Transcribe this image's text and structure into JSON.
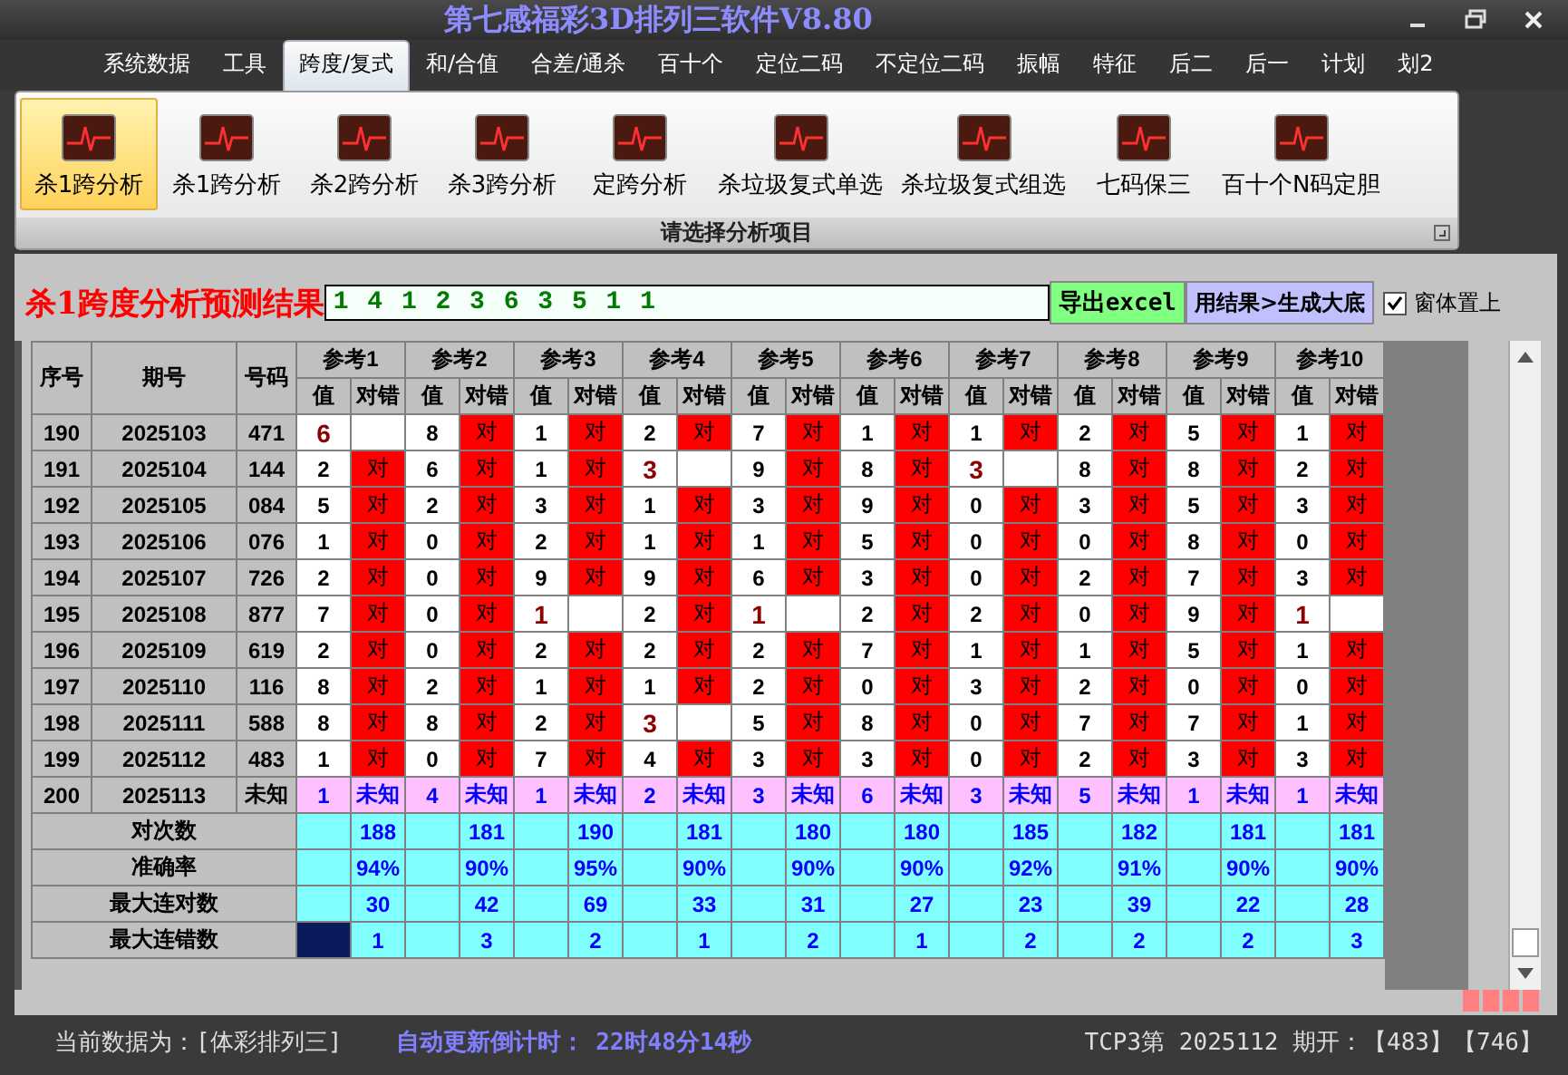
{
  "window": {
    "title": "第七感福彩3D排列三软件V8.80"
  },
  "menu": [
    {
      "label": "系统数据",
      "selected": false
    },
    {
      "label": "工具",
      "selected": false
    },
    {
      "label": "跨度/复式",
      "selected": true
    },
    {
      "label": "和/合值",
      "selected": false
    },
    {
      "label": "合差/通杀",
      "selected": false
    },
    {
      "label": "百十个",
      "selected": false
    },
    {
      "label": "定位二码",
      "selected": false
    },
    {
      "label": "不定位二码",
      "selected": false
    },
    {
      "label": "振幅",
      "selected": false
    },
    {
      "label": "特征",
      "selected": false
    },
    {
      "label": "后二",
      "selected": false
    },
    {
      "label": "后一",
      "selected": false
    },
    {
      "label": "计划",
      "selected": false
    },
    {
      "label": "划2",
      "selected": false
    }
  ],
  "ribbon": {
    "items": [
      {
        "label": "杀1跨分析",
        "selected": true
      },
      {
        "label": "杀1跨分析",
        "selected": false
      },
      {
        "label": "杀2跨分析",
        "selected": false
      },
      {
        "label": "杀3跨分析",
        "selected": false
      },
      {
        "label": "定跨分析",
        "selected": false
      },
      {
        "label": "杀垃圾复式单选",
        "selected": false
      },
      {
        "label": "杀垃圾复式组选",
        "selected": false
      },
      {
        "label": "七码保三",
        "selected": false
      },
      {
        "label": "百十个N码定胆",
        "selected": false
      }
    ],
    "group_label": "请选择分析项目"
  },
  "result": {
    "title": "杀1跨度分析预测结果",
    "value": "1 4 1 2 3 6 3 5 1 1",
    "export_button": "导出excel",
    "generate_button": "用结果>生成大底",
    "pin_checkbox": {
      "label": "窗体置上",
      "checked": true
    }
  },
  "table": {
    "columns": [
      "序号",
      "期号",
      "号码"
    ],
    "groups": [
      {
        "label": "参考1",
        "subcolumns": [
          "值",
          "对错"
        ]
      },
      {
        "label": "参考2",
        "subcolumns": [
          "值",
          "对错"
        ]
      },
      {
        "label": "参考3",
        "subcolumns": [
          "值",
          "对错"
        ]
      },
      {
        "label": "参考4",
        "subcolumns": [
          "值",
          "对错"
        ]
      },
      {
        "label": "参考5",
        "subcolumns": [
          "值",
          "对错"
        ]
      },
      {
        "label": "参考6",
        "subcolumns": [
          "值",
          "对错"
        ]
      },
      {
        "label": "参考7",
        "subcolumns": [
          "值",
          "对错"
        ]
      },
      {
        "label": "参考8",
        "subcolumns": [
          "值",
          "对错"
        ]
      },
      {
        "label": "参考9",
        "subcolumns": [
          "值",
          "对错"
        ]
      },
      {
        "label": "参考10",
        "subcolumns": [
          "值",
          "对错"
        ]
      }
    ],
    "rows": [
      {
        "kind": "history",
        "seq": "190",
        "period": "2025103",
        "number": "471",
        "cells": [
          {
            "value": "6",
            "hit": false
          },
          {
            "value": "8",
            "hit": true,
            "result": "对"
          },
          {
            "value": "1",
            "hit": true,
            "result": "对"
          },
          {
            "value": "2",
            "hit": true,
            "result": "对"
          },
          {
            "value": "7",
            "hit": true,
            "result": "对"
          },
          {
            "value": "1",
            "hit": true,
            "result": "对"
          },
          {
            "value": "1",
            "hit": true,
            "result": "对"
          },
          {
            "value": "2",
            "hit": true,
            "result": "对"
          },
          {
            "value": "5",
            "hit": true,
            "result": "对"
          },
          {
            "value": "1",
            "hit": true,
            "result": "对"
          }
        ]
      },
      {
        "kind": "history",
        "seq": "191",
        "period": "2025104",
        "number": "144",
        "cells": [
          {
            "value": "2",
            "hit": true,
            "result": "对"
          },
          {
            "value": "6",
            "hit": true,
            "result": "对"
          },
          {
            "value": "1",
            "hit": true,
            "result": "对"
          },
          {
            "value": "3",
            "hit": false
          },
          {
            "value": "9",
            "hit": true,
            "result": "对"
          },
          {
            "value": "8",
            "hit": true,
            "result": "对"
          },
          {
            "value": "3",
            "hit": false
          },
          {
            "value": "8",
            "hit": true,
            "result": "对"
          },
          {
            "value": "8",
            "hit": true,
            "result": "对"
          },
          {
            "value": "2",
            "hit": true,
            "result": "对"
          }
        ]
      },
      {
        "kind": "history",
        "seq": "192",
        "period": "2025105",
        "number": "084",
        "cells": [
          {
            "value": "5",
            "hit": true,
            "result": "对"
          },
          {
            "value": "2",
            "hit": true,
            "result": "对"
          },
          {
            "value": "3",
            "hit": true,
            "result": "对"
          },
          {
            "value": "1",
            "hit": true,
            "result": "对"
          },
          {
            "value": "3",
            "hit": true,
            "result": "对"
          },
          {
            "value": "9",
            "hit": true,
            "result": "对"
          },
          {
            "value": "0",
            "hit": true,
            "result": "对"
          },
          {
            "value": "3",
            "hit": true,
            "result": "对"
          },
          {
            "value": "5",
            "hit": true,
            "result": "对"
          },
          {
            "value": "3",
            "hit": true,
            "result": "对"
          }
        ]
      },
      {
        "kind": "history",
        "seq": "193",
        "period": "2025106",
        "number": "076",
        "cells": [
          {
            "value": "1",
            "hit": true,
            "result": "对"
          },
          {
            "value": "0",
            "hit": true,
            "result": "对"
          },
          {
            "value": "2",
            "hit": true,
            "result": "对"
          },
          {
            "value": "1",
            "hit": true,
            "result": "对"
          },
          {
            "value": "1",
            "hit": true,
            "result": "对"
          },
          {
            "value": "5",
            "hit": true,
            "result": "对"
          },
          {
            "value": "0",
            "hit": true,
            "result": "对"
          },
          {
            "value": "0",
            "hit": true,
            "result": "对"
          },
          {
            "value": "8",
            "hit": true,
            "result": "对"
          },
          {
            "value": "0",
            "hit": true,
            "result": "对"
          }
        ]
      },
      {
        "kind": "history",
        "seq": "194",
        "period": "2025107",
        "number": "726",
        "cells": [
          {
            "value": "2",
            "hit": true,
            "result": "对"
          },
          {
            "value": "0",
            "hit": true,
            "result": "对"
          },
          {
            "value": "9",
            "hit": true,
            "result": "对"
          },
          {
            "value": "9",
            "hit": true,
            "result": "对"
          },
          {
            "value": "6",
            "hit": true,
            "result": "对"
          },
          {
            "value": "3",
            "hit": true,
            "result": "对"
          },
          {
            "value": "0",
            "hit": true,
            "result": "对"
          },
          {
            "value": "2",
            "hit": true,
            "result": "对"
          },
          {
            "value": "7",
            "hit": true,
            "result": "对"
          },
          {
            "value": "3",
            "hit": true,
            "result": "对"
          }
        ]
      },
      {
        "kind": "history",
        "seq": "195",
        "period": "2025108",
        "number": "877",
        "cells": [
          {
            "value": "7",
            "hit": true,
            "result": "对"
          },
          {
            "value": "0",
            "hit": true,
            "result": "对"
          },
          {
            "value": "1",
            "hit": false
          },
          {
            "value": "2",
            "hit": true,
            "result": "对"
          },
          {
            "value": "1",
            "hit": false
          },
          {
            "value": "2",
            "hit": true,
            "result": "对"
          },
          {
            "value": "2",
            "hit": true,
            "result": "对"
          },
          {
            "value": "0",
            "hit": true,
            "result": "对"
          },
          {
            "value": "9",
            "hit": true,
            "result": "对"
          },
          {
            "value": "1",
            "hit": false
          }
        ]
      },
      {
        "kind": "history",
        "seq": "196",
        "period": "2025109",
        "number": "619",
        "cells": [
          {
            "value": "2",
            "hit": true,
            "result": "对"
          },
          {
            "value": "0",
            "hit": true,
            "result": "对"
          },
          {
            "value": "2",
            "hit": true,
            "result": "对"
          },
          {
            "value": "2",
            "hit": true,
            "result": "对"
          },
          {
            "value": "2",
            "hit": true,
            "result": "对"
          },
          {
            "value": "7",
            "hit": true,
            "result": "对"
          },
          {
            "value": "1",
            "hit": true,
            "result": "对"
          },
          {
            "value": "1",
            "hit": true,
            "result": "对"
          },
          {
            "value": "5",
            "hit": true,
            "result": "对"
          },
          {
            "value": "1",
            "hit": true,
            "result": "对"
          }
        ]
      },
      {
        "kind": "history",
        "seq": "197",
        "period": "2025110",
        "number": "116",
        "cells": [
          {
            "value": "8",
            "hit": true,
            "result": "对"
          },
          {
            "value": "2",
            "hit": true,
            "result": "对"
          },
          {
            "value": "1",
            "hit": true,
            "result": "对"
          },
          {
            "value": "1",
            "hit": true,
            "result": "对"
          },
          {
            "value": "2",
            "hit": true,
            "result": "对"
          },
          {
            "value": "0",
            "hit": true,
            "result": "对"
          },
          {
            "value": "3",
            "hit": true,
            "result": "对"
          },
          {
            "value": "2",
            "hit": true,
            "result": "对"
          },
          {
            "value": "0",
            "hit": true,
            "result": "对"
          },
          {
            "value": "0",
            "hit": true,
            "result": "对"
          }
        ]
      },
      {
        "kind": "history",
        "seq": "198",
        "period": "2025111",
        "number": "588",
        "cells": [
          {
            "value": "8",
            "hit": true,
            "result": "对"
          },
          {
            "value": "8",
            "hit": true,
            "result": "对"
          },
          {
            "value": "2",
            "hit": true,
            "result": "对"
          },
          {
            "value": "3",
            "hit": false
          },
          {
            "value": "5",
            "hit": true,
            "result": "对"
          },
          {
            "value": "8",
            "hit": true,
            "result": "对"
          },
          {
            "value": "0",
            "hit": true,
            "result": "对"
          },
          {
            "value": "7",
            "hit": true,
            "result": "对"
          },
          {
            "value": "7",
            "hit": true,
            "result": "对"
          },
          {
            "value": "1",
            "hit": true,
            "result": "对"
          }
        ]
      },
      {
        "kind": "history",
        "seq": "199",
        "period": "2025112",
        "number": "483",
        "cells": [
          {
            "value": "1",
            "hit": true,
            "result": "对"
          },
          {
            "value": "0",
            "hit": true,
            "result": "对"
          },
          {
            "value": "7",
            "hit": true,
            "result": "对"
          },
          {
            "value": "4",
            "hit": true,
            "result": "对"
          },
          {
            "value": "3",
            "hit": true,
            "result": "对"
          },
          {
            "value": "3",
            "hit": true,
            "result": "对"
          },
          {
            "value": "0",
            "hit": true,
            "result": "对"
          },
          {
            "value": "2",
            "hit": true,
            "result": "对"
          },
          {
            "value": "3",
            "hit": true,
            "result": "对"
          },
          {
            "value": "3",
            "hit": true,
            "result": "对"
          }
        ]
      },
      {
        "kind": "pending",
        "seq": "200",
        "period": "2025113",
        "number": "未知",
        "cells": [
          {
            "value": "1",
            "result": "未知"
          },
          {
            "value": "4",
            "result": "未知"
          },
          {
            "value": "1",
            "result": "未知"
          },
          {
            "value": "2",
            "result": "未知"
          },
          {
            "value": "3",
            "result": "未知"
          },
          {
            "value": "6",
            "result": "未知"
          },
          {
            "value": "3",
            "result": "未知"
          },
          {
            "value": "5",
            "result": "未知"
          },
          {
            "value": "1",
            "result": "未知"
          },
          {
            "value": "1",
            "result": "未知"
          }
        ]
      }
    ],
    "stats": [
      {
        "label": "对次数",
        "cells": [
          {
            "value": "188",
            "selected": false
          },
          {
            "value": "181",
            "selected": false
          },
          {
            "value": "190",
            "selected": false
          },
          {
            "value": "181",
            "selected": false
          },
          {
            "value": "180",
            "selected": false
          },
          {
            "value": "180",
            "selected": false
          },
          {
            "value": "185",
            "selected": false
          },
          {
            "value": "182",
            "selected": false
          },
          {
            "value": "181",
            "selected": false
          },
          {
            "value": "181",
            "selected": false
          }
        ]
      },
      {
        "label": "准确率",
        "cells": [
          {
            "value": "94%",
            "selected": false
          },
          {
            "value": "90%",
            "selected": false
          },
          {
            "value": "95%",
            "selected": false
          },
          {
            "value": "90%",
            "selected": false
          },
          {
            "value": "90%",
            "selected": false
          },
          {
            "value": "90%",
            "selected": false
          },
          {
            "value": "92%",
            "selected": false
          },
          {
            "value": "91%",
            "selected": false
          },
          {
            "value": "90%",
            "selected": false
          },
          {
            "value": "90%",
            "selected": false
          }
        ]
      },
      {
        "label": "最大连对数",
        "cells": [
          {
            "value": "30",
            "selected": false
          },
          {
            "value": "42",
            "selected": false
          },
          {
            "value": "69",
            "selected": false
          },
          {
            "value": "33",
            "selected": false
          },
          {
            "value": "31",
            "selected": false
          },
          {
            "value": "27",
            "selected": false
          },
          {
            "value": "23",
            "selected": false
          },
          {
            "value": "39",
            "selected": false
          },
          {
            "value": "22",
            "selected": false
          },
          {
            "value": "28",
            "selected": false
          }
        ]
      },
      {
        "label": "最大连错数",
        "cells": [
          {
            "value": "1",
            "selected": true
          },
          {
            "value": "3",
            "selected": false
          },
          {
            "value": "2",
            "selected": false
          },
          {
            "value": "1",
            "selected": false
          },
          {
            "value": "2",
            "selected": false
          },
          {
            "value": "1",
            "selected": false
          },
          {
            "value": "2",
            "selected": false
          },
          {
            "value": "2",
            "selected": false
          },
          {
            "value": "2",
            "selected": false
          },
          {
            "value": "3",
            "selected": false
          }
        ]
      }
    ]
  },
  "status_bar": {
    "data_source": "当前数据为：[体彩排列三]",
    "countdown_label": "自动更新倒计时：",
    "countdown": "22时48分14秒",
    "latest_draw": "TCP3第 2025112 期开：【483】【746】"
  }
}
